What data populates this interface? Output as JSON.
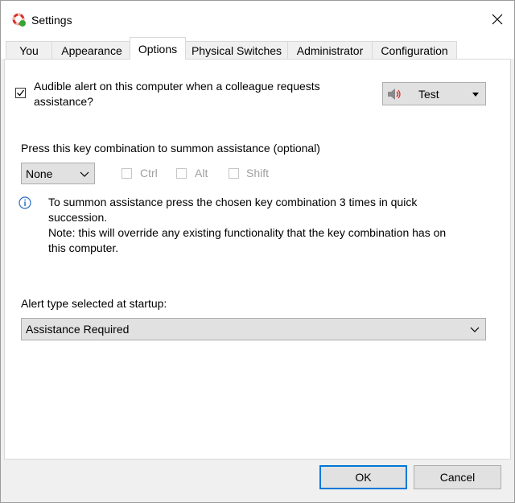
{
  "window": {
    "title": "Settings"
  },
  "tabs": [
    "You",
    "Appearance",
    "Options",
    "Physical Switches",
    "Administrator",
    "Configuration"
  ],
  "options": {
    "audible_alert_line1": "Audible alert on this computer when a colleague requests",
    "audible_alert_line2": "assistance?",
    "test_button": "Test",
    "key_combo_label": "Press this key combination to summon assistance (optional)",
    "key_select_value": "None",
    "ctrl_label": "Ctrl",
    "alt_label": "Alt",
    "shift_label": "Shift",
    "info_line1": "To summon assistance press the chosen key combination 3 times in quick",
    "info_line2": "succession.",
    "info_line3": "Note: this will override any existing functionality that the key combination has on",
    "info_line4": "this computer.",
    "alert_type_label": "Alert type selected at startup:",
    "alert_type_value": "Assistance Required"
  },
  "footer": {
    "ok_label": "OK",
    "cancel_label": "Cancel"
  },
  "colors": {
    "accent": "#0078d7",
    "info": "#2b6cc4",
    "speaker_red": "#d9302c"
  }
}
